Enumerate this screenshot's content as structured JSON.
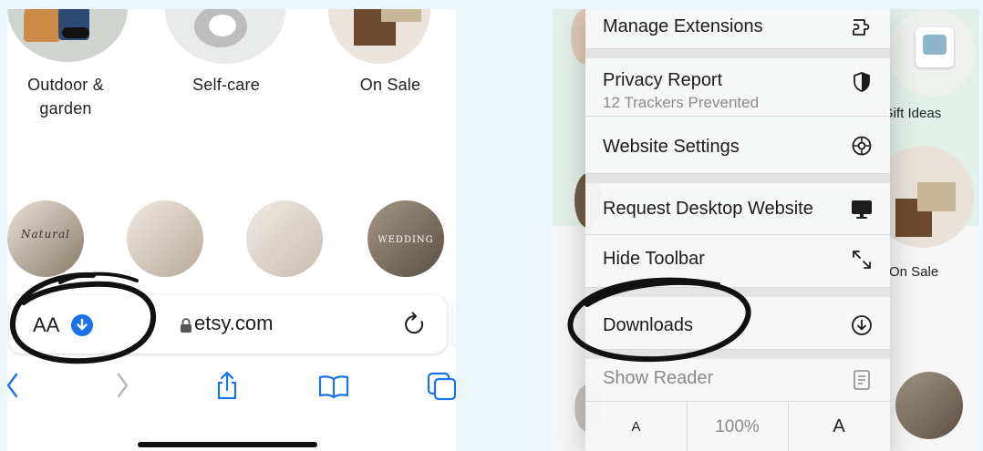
{
  "left": {
    "categories": [
      {
        "label": "Outdoor & garden"
      },
      {
        "label": "Self-care"
      },
      {
        "label": "On Sale"
      }
    ],
    "photos": [
      {
        "overlay": "Natural"
      },
      {
        "overlay": ""
      },
      {
        "overlay": ""
      },
      {
        "overlay": "WEDDING"
      }
    ],
    "address_bar": {
      "text_size_label": "AA",
      "url": "etsy.com"
    },
    "toolbar": {
      "back_icon": "chevron-left-icon",
      "forward_icon": "chevron-right-icon",
      "share_icon": "share-icon",
      "bookmarks_icon": "book-icon",
      "tabs_icon": "tabs-icon"
    }
  },
  "right": {
    "background_labels": {
      "gift_ideas": "Gift Ideas",
      "on_sale": "On Sale"
    },
    "menu": {
      "items": [
        {
          "label": "Manage Extensions",
          "icon": "extension-icon"
        },
        {
          "label": "Privacy Report",
          "sub": "12 Trackers Prevented",
          "icon": "shield-icon"
        },
        {
          "label": "Website Settings",
          "icon": "gear-icon"
        },
        {
          "label": "Request Desktop Website",
          "icon": "desktop-icon"
        },
        {
          "label": "Hide Toolbar",
          "icon": "expand-icon"
        },
        {
          "label": "Downloads",
          "icon": "download-icon"
        },
        {
          "label": "Show Reader",
          "icon": "reader-icon"
        }
      ],
      "zoom": {
        "smaller": "A",
        "level": "100%",
        "larger": "A"
      }
    }
  },
  "colors": {
    "accent_blue": "#1a73e8",
    "disabled_text": "#8a8a8e",
    "mint_band": "#e3efe9"
  }
}
